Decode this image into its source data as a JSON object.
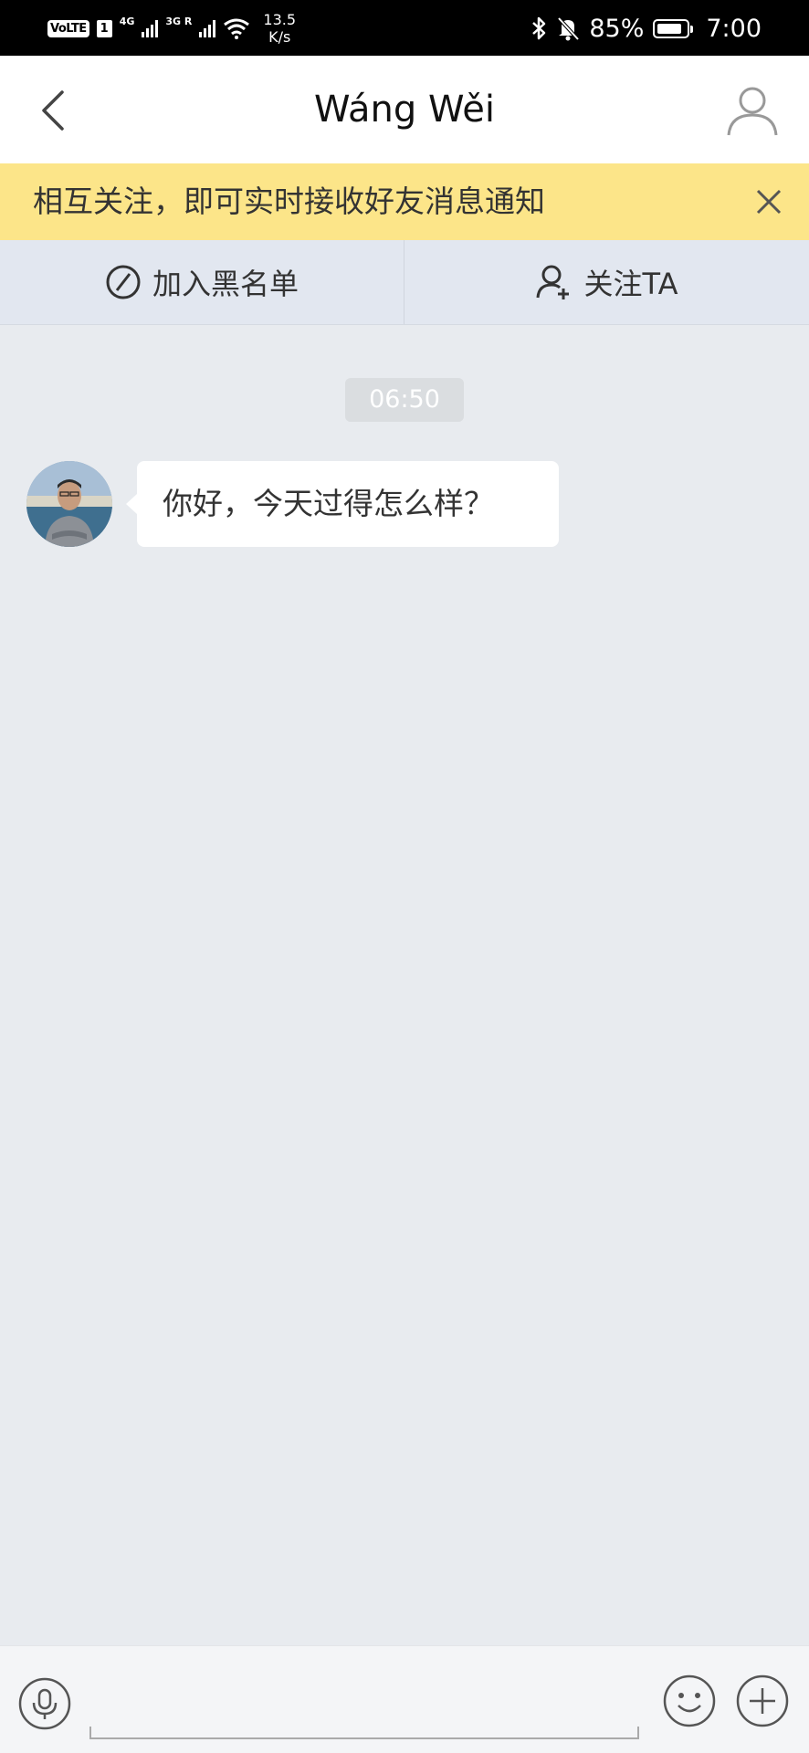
{
  "status_bar": {
    "volte": "VoLTE",
    "sim": "1",
    "net1": "4G",
    "net2": "3G R",
    "speed_value": "13.5",
    "speed_unit": "K/s",
    "battery": "85%",
    "battery_level": 0.85,
    "time": "7:00"
  },
  "header": {
    "title": "Wáng Wěi"
  },
  "notice": {
    "text": "相互关注，即可实时接收好友消息通知"
  },
  "actions": {
    "blacklist_label": "加入黑名单",
    "follow_label": "关注TA"
  },
  "chat": {
    "timestamp": "06:50",
    "messages": [
      {
        "text": "你好，今天过得怎么样？"
      }
    ]
  },
  "input_bar": {
    "placeholder": ""
  },
  "colors": {
    "notice_bg": "#FCE589",
    "action_bar_bg": "#E2E7F0",
    "chat_bg": "#E8EBEF"
  }
}
